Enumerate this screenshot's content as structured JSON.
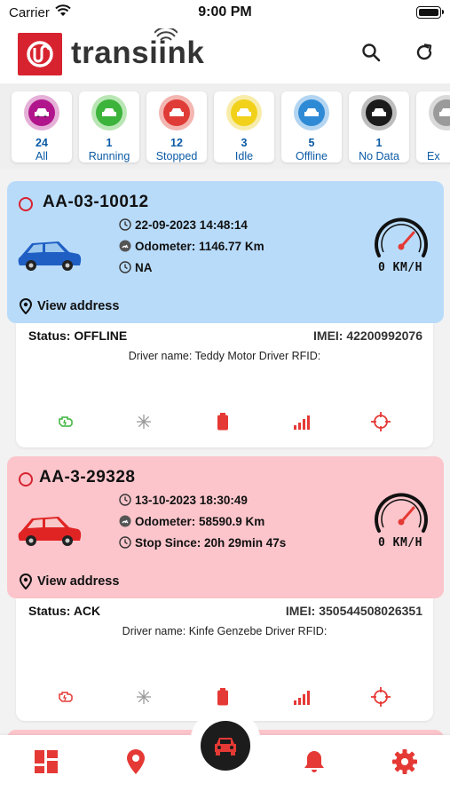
{
  "status_bar": {
    "carrier": "Carrier",
    "time": "9:00 PM"
  },
  "header": {
    "brand": "transiink"
  },
  "filters": [
    {
      "count": "24",
      "label": "All",
      "color": "#b1158c",
      "ring": "#e5b0d7"
    },
    {
      "count": "1",
      "label": "Running",
      "color": "#3cb33b",
      "ring": "#b9e6b4"
    },
    {
      "count": "12",
      "label": "Stopped",
      "color": "#e03c37",
      "ring": "#f3b6b1"
    },
    {
      "count": "3",
      "label": "Idle",
      "color": "#f1d11a",
      "ring": "#f8ecaa"
    },
    {
      "count": "5",
      "label": "Offline",
      "color": "#2f8ad6",
      "ring": "#b3d5f1"
    },
    {
      "count": "1",
      "label": "No Data",
      "color": "#1b1b1b",
      "ring": "#bdbdbd"
    },
    {
      "count": "",
      "label": "Ex",
      "color": "#9a9a9a",
      "ring": "#d9d9d9"
    }
  ],
  "vehicles": [
    {
      "plate": "AA-03-10012",
      "datetime": "22-09-2023 14:48:14",
      "odometer": "Odometer: 1146.77 Km",
      "extra": "NA",
      "speed": "0 KM/H",
      "view_address": "View address",
      "status": "Status: OFFLINE",
      "imei": "IMEI: 42200992076",
      "driver": "Driver name:  Teddy Motor Driver RFID:",
      "bg": "#b8dbfa",
      "car_color": "#1f5fc4"
    },
    {
      "plate": "AA-3-29328",
      "datetime": "13-10-2023 18:30:49",
      "odometer": "Odometer: 58590.9 Km",
      "extra": "Stop Since: 20h 29min 47s",
      "speed": "0 KM/H",
      "view_address": "View address",
      "status": "Status: ACK",
      "imei": "IMEI: 350544508026351",
      "driver": "Driver name:  Kinfe Genzebe Driver RFID:",
      "bg": "#fbc5cb",
      "car_color": "#e02424"
    }
  ],
  "colors": {
    "accent_red": "#e53935",
    "link_blue": "#0b5aa5",
    "engine_green": "#3cb33b"
  }
}
